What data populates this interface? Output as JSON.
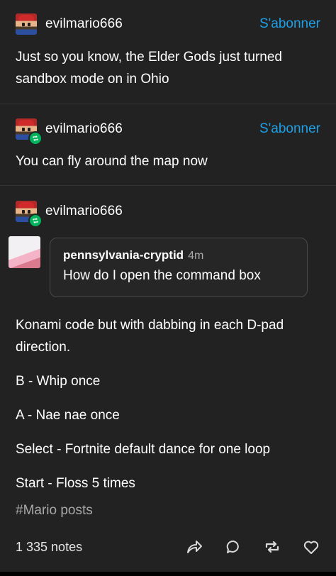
{
  "posts": [
    {
      "username": "evilmario666",
      "follow_label": "S'abonner",
      "text": "Just so you know, the Elder Gods just turned sandbox mode on in Ohio"
    },
    {
      "username": "evilmario666",
      "follow_label": "S'abonner",
      "text": "You can fly around the map now"
    },
    {
      "username": "evilmario666",
      "quote": {
        "username": "pennsylvania-cryptid",
        "time": "4m",
        "text": "How do I open the command box"
      },
      "paragraphs": [
        "Konami code but with dabbing in each D-pad direction.",
        "B - Whip once",
        "A - Nae nae once",
        "Select - Fortnite default dance for one loop",
        "Start - Floss 5 times"
      ],
      "tag": "#Mario posts"
    }
  ],
  "footer": {
    "notes": "1 335 notes",
    "icons": [
      "share-icon",
      "reply-icon",
      "reblog-icon",
      "like-icon"
    ]
  },
  "colors": {
    "background": "#222222",
    "accent": "#1ea0e8",
    "reblog_green": "#00b35c"
  }
}
